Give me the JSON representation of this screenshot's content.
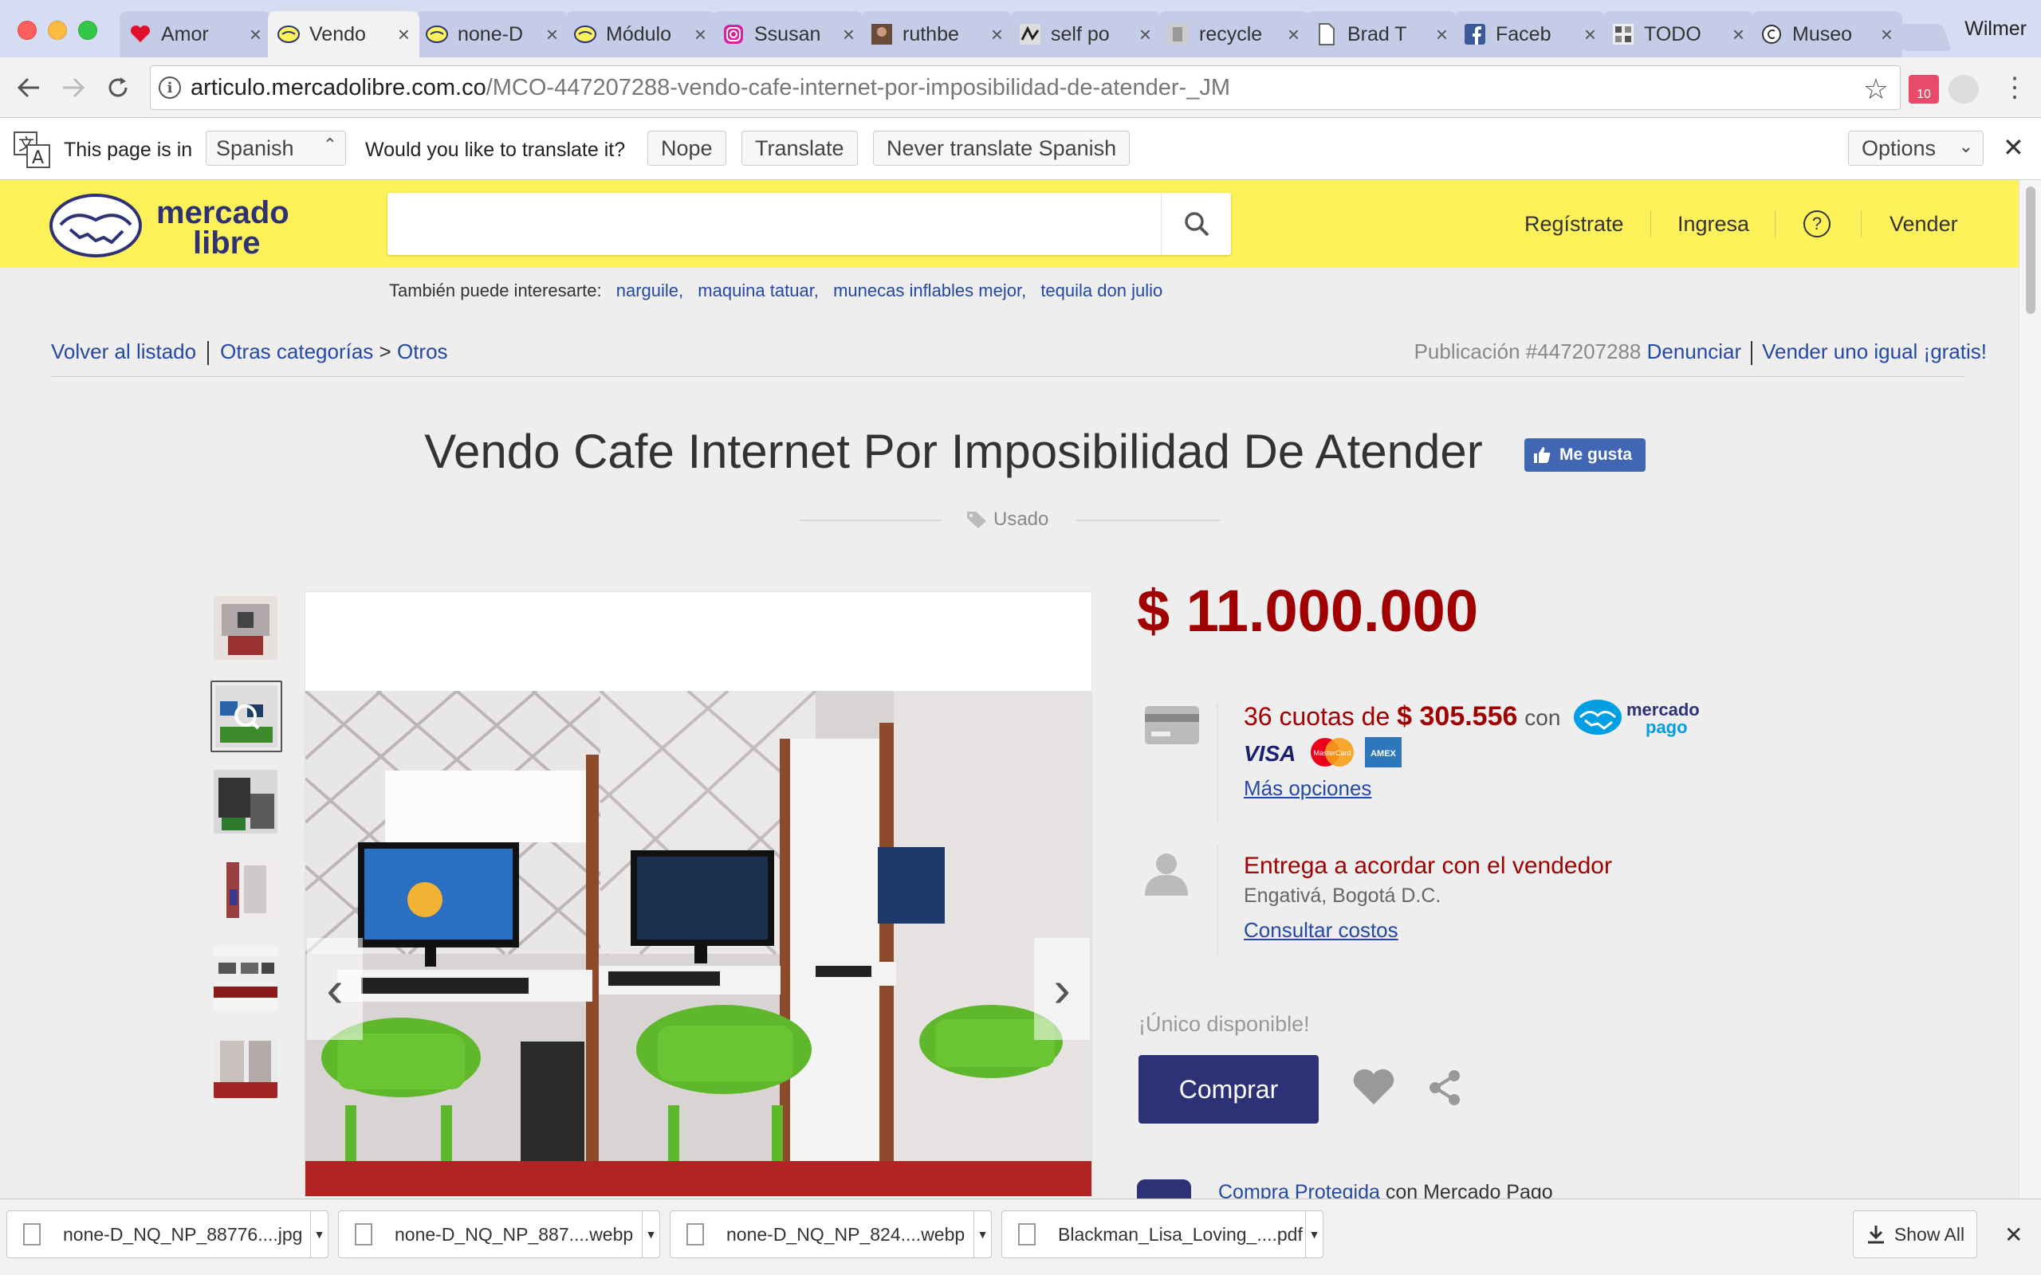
{
  "browser": {
    "profile": "Wilmer",
    "tabs": [
      {
        "label": "Amor",
        "icon": "heart-icon"
      },
      {
        "label": "Vendo",
        "icon": "mercadolibre-icon",
        "active": true
      },
      {
        "label": "none-D",
        "icon": "mercadolibre-icon"
      },
      {
        "label": "Módulo",
        "icon": "mercadolibre-icon"
      },
      {
        "label": "Ssusan",
        "icon": "instagram-icon"
      },
      {
        "label": "ruthbe",
        "icon": "photo-icon"
      },
      {
        "label": "self po",
        "icon": "image-icon"
      },
      {
        "label": "recycle",
        "icon": "image-icon"
      },
      {
        "label": "Brad T",
        "icon": "document-icon"
      },
      {
        "label": "Faceb",
        "icon": "facebook-icon"
      },
      {
        "label": "TODO",
        "icon": "image-icon"
      },
      {
        "label": "Museo",
        "icon": "copyright-icon"
      }
    ],
    "url_host": "articulo.mercadolibre.com.co",
    "url_path": "/MCO-447207288-vendo-cafe-internet-por-imposibilidad-de-atender-_JM",
    "extension_badge": "10"
  },
  "translate_bar": {
    "this_page_is_in": "This page is in",
    "language": "Spanish",
    "question": "Would you like to translate it?",
    "nope": "Nope",
    "translate": "Translate",
    "never": "Never translate Spanish",
    "options": "Options"
  },
  "header": {
    "logo_line1": "mercado",
    "logo_line2": "libre",
    "search_placeholder": "",
    "nav": {
      "register": "Regístrate",
      "login": "Ingresa",
      "help": "?",
      "sell": "Vender"
    }
  },
  "suggestions": {
    "label": "También puede interesarte:",
    "items": [
      "narguile,",
      "maquina tatuar,",
      "munecas inflables mejor,",
      "tequila don julio"
    ]
  },
  "breadcrumb": {
    "back": "Volver al listado",
    "other_categories": "Otras categorías",
    "arrow": ">",
    "category": "Otros"
  },
  "publication": {
    "number": "Publicación #447207288",
    "report": "Denunciar",
    "sell_same": "Vender uno igual ¡gratis!"
  },
  "product": {
    "title": "Vendo Cafe Internet Por Imposibilidad De Atender",
    "like": "Me gusta",
    "condition": "Usado",
    "price": "$ 11.000.000",
    "installments_prefix": "36 cuotas de",
    "installment_amount": "$ 305.556",
    "installments_con": "con",
    "mp_logo_line1": "mercado",
    "mp_logo_line2": "pago",
    "card_visa": "VISA",
    "card_mc": "MasterCard",
    "card_amex": "AMEX",
    "more_options": "Más opciones",
    "shipping_title": "Entrega a acordar con el vendedor",
    "location": "Engativá, Bogotá D.C.",
    "shipping_costs": "Consultar costos",
    "stock": "¡Único disponible!",
    "buy": "Comprar",
    "protected_link": "Compra Protegida",
    "protected_suffix": "con Mercado Pago"
  },
  "downloads": {
    "items": [
      "none-D_NQ_NP_88776....jpg",
      "none-D_NQ_NP_887....webp",
      "none-D_NQ_NP_824....webp",
      "Blackman_Lisa_Loving_....pdf"
    ],
    "show_all": "Show All"
  },
  "colors": {
    "brand_yellow": "#fff159",
    "price_red": "#a00000",
    "buy_button": "#2d3277",
    "link_blue": "#2448a4"
  }
}
